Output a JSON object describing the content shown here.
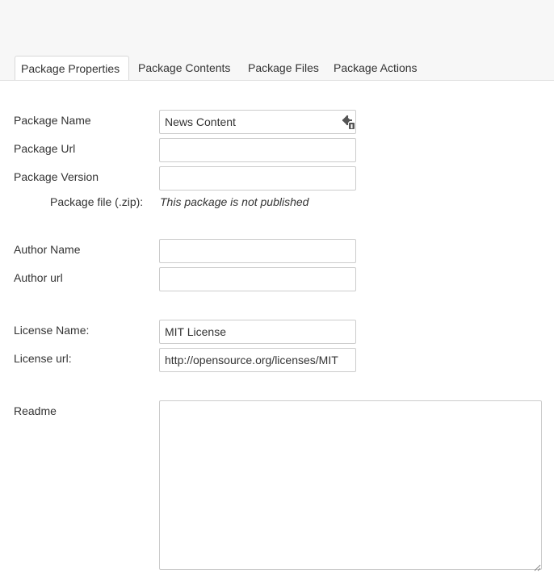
{
  "tabs": [
    {
      "label": "Package Properties",
      "active": true
    },
    {
      "label": "Package Contents",
      "active": false
    },
    {
      "label": "Package Files",
      "active": false
    },
    {
      "label": "Package Actions",
      "active": false
    }
  ],
  "form": {
    "package_name": {
      "label": "Package Name",
      "value": "News Content"
    },
    "package_url": {
      "label": "Package Url",
      "value": ""
    },
    "package_version": {
      "label": "Package Version",
      "value": ""
    },
    "package_file": {
      "label": "Package file (.zip):",
      "value": "This package is not published"
    },
    "author_name": {
      "label": "Author Name",
      "value": ""
    },
    "author_url": {
      "label": "Author url",
      "value": ""
    },
    "license_name": {
      "label": "License Name:",
      "value": "MIT License"
    },
    "license_url": {
      "label": "License url:",
      "value": "http://opensource.org/licenses/MIT"
    },
    "readme": {
      "label": "Readme",
      "value": ""
    }
  },
  "icons": {
    "package_name_field_icon": "macro-icon"
  },
  "colors": {
    "background": "#ffffff",
    "header_background": "#f7f7f7",
    "border": "#cccccc",
    "text": "#333333"
  }
}
